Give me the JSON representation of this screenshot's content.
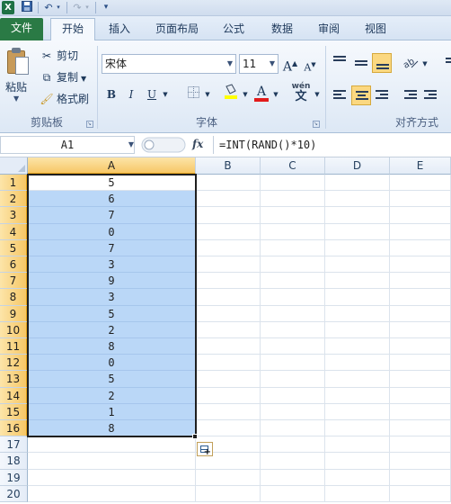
{
  "quick_access": {
    "app_icon": "X",
    "save_icon": "save-icon",
    "undo_icon": "undo-icon",
    "redo_icon": "redo-icon",
    "customize_icon": "dropdown-icon"
  },
  "tabs": [
    {
      "label": "文件"
    },
    {
      "label": "开始"
    },
    {
      "label": "插入"
    },
    {
      "label": "页面布局"
    },
    {
      "label": "公式"
    },
    {
      "label": "数据"
    },
    {
      "label": "审阅"
    },
    {
      "label": "视图"
    }
  ],
  "clipboard": {
    "paste_label": "粘贴",
    "cut_label": "剪切",
    "copy_label": "复制",
    "format_painter_label": "格式刷",
    "group_label": "剪贴板"
  },
  "font": {
    "font_name": "宋体",
    "font_size": "11",
    "bold": "B",
    "italic": "I",
    "underline": "U",
    "grow": "A",
    "shrink": "A",
    "font_color": "A",
    "phonetic": "wén",
    "phonetic_char": "文",
    "group_label": "字体"
  },
  "alignment": {
    "group_label": "对齐方式"
  },
  "formula_bar": {
    "name_box": "A1",
    "fx": "fx",
    "formula": "=INT(RAND()*10)"
  },
  "columns": [
    "A",
    "B",
    "C",
    "D",
    "E"
  ],
  "rows": [
    "1",
    "2",
    "3",
    "4",
    "5",
    "6",
    "7",
    "8",
    "9",
    "10",
    "11",
    "12",
    "13",
    "14",
    "15",
    "16",
    "17",
    "18",
    "19",
    "20"
  ],
  "cells_A": [
    "5",
    "6",
    "7",
    "0",
    "7",
    "3",
    "9",
    "3",
    "5",
    "2",
    "8",
    "0",
    "5",
    "2",
    "1",
    "8"
  ],
  "selection": {
    "range": "A1:A16",
    "active": "A1"
  },
  "colors": {
    "selection_fill": "#bad7f7",
    "header_highlight": "#f7c766",
    "file_tab": "#2a7a45"
  }
}
